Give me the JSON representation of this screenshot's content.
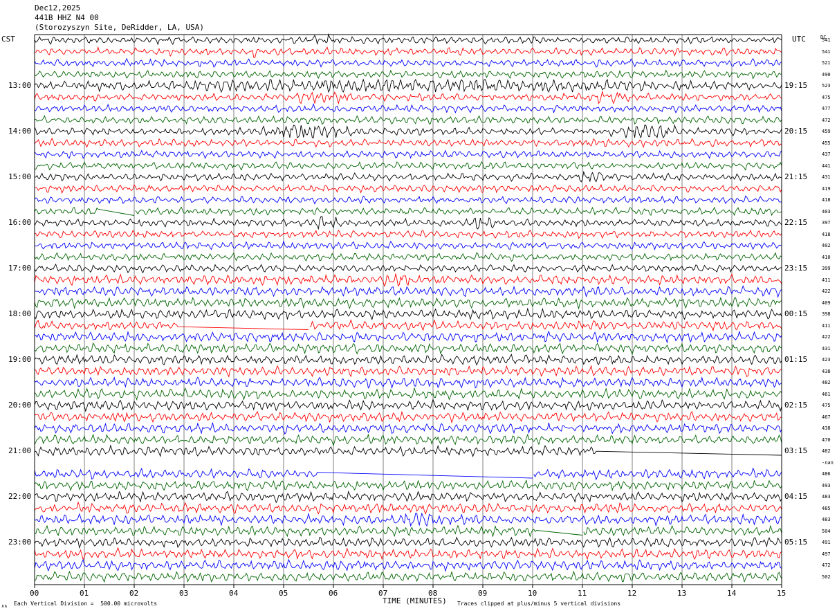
{
  "header": {
    "date": "Dec12,2025",
    "station": "441B HHZ N4 00",
    "site": "(Storozyszyn Site, DeRidder, LA, USA)"
  },
  "labels": {
    "left_zone": "CST",
    "right_zone": "UTC",
    "dc_label": "DC",
    "xlabel": "TIME (MINUTES)",
    "scale_note": "Each Vertical Division =  500.00 microvolts",
    "clip_note": "Traces clipped at plus/minus 5 vertical divisions",
    "corner_mark": "∧∧"
  },
  "chart_data": {
    "type": "line",
    "xlim": [
      0,
      15
    ],
    "x_ticks": [
      "00",
      "01",
      "02",
      "03",
      "04",
      "05",
      "06",
      "07",
      "08",
      "09",
      "10",
      "11",
      "12",
      "13",
      "14",
      "15"
    ],
    "left_hour_labels": [
      "13:00",
      "14:00",
      "15:00",
      "16:00",
      "17:00",
      "18:00",
      "19:00",
      "20:00",
      "21:00",
      "22:00",
      "23:00"
    ],
    "right_hour_labels": [
      "19:15",
      "20:15",
      "21:15",
      "22:15",
      "23:15",
      "00:15",
      "01:15",
      "02:15",
      "03:15",
      "04:15",
      "05:15"
    ],
    "trace_colors": [
      "#000000",
      "#ff0000",
      "#0000ff",
      "#006400"
    ],
    "traces_per_hour": 4,
    "trace_count": 48,
    "dc_offsets": [
      "541",
      "541",
      "521",
      "490",
      "523",
      "475",
      "477",
      "472",
      "459",
      "455",
      "437",
      "441",
      "431",
      "419",
      "418",
      "403",
      "397",
      "418",
      "402",
      "410",
      "399",
      "411",
      "422",
      "409",
      "398",
      "411",
      "422",
      "431",
      "423",
      "438",
      "482",
      "461",
      "475",
      "467",
      "438",
      "470",
      "482",
      "-nan",
      "486",
      "493",
      "483",
      "485",
      "483",
      "504",
      "491",
      "497",
      "472",
      "502"
    ],
    "events": [
      {
        "trace": 0,
        "start_min": 5.5,
        "end_min": 6.2,
        "amp": 1.4
      },
      {
        "trace": 1,
        "start_min": 4.2,
        "end_min": 4.6,
        "amp": 1.3
      },
      {
        "trace": 4,
        "start_min": 0.0,
        "end_min": 15.0,
        "amp": 1.6
      },
      {
        "trace": 5,
        "start_min": 5.0,
        "end_min": 6.5,
        "amp": 1.5
      },
      {
        "trace": 5,
        "start_min": 11.0,
        "end_min": 12.0,
        "amp": 1.5
      },
      {
        "trace": 8,
        "start_min": 4.5,
        "end_min": 6.5,
        "amp": 2.2
      },
      {
        "trace": 8,
        "start_min": 11.5,
        "end_min": 13.0,
        "amp": 2.0
      },
      {
        "trace": 12,
        "start_min": 10.8,
        "end_min": 11.5,
        "amp": 1.6
      },
      {
        "trace": 16,
        "start_min": 5.5,
        "end_min": 6.2,
        "amp": 1.8
      },
      {
        "trace": 16,
        "start_min": 8.6,
        "end_min": 9.3,
        "amp": 1.6
      },
      {
        "trace": 21,
        "start_min": 7.0,
        "end_min": 7.6,
        "amp": 1.5
      },
      {
        "trace": 42,
        "start_min": 7.3,
        "end_min": 8.2,
        "amp": 2.0
      }
    ],
    "gaps": [
      {
        "trace": 15,
        "start_min": 1.3,
        "end_min": 2.0
      },
      {
        "trace": 25,
        "start_min": 2.9,
        "end_min": 5.5
      },
      {
        "trace": 36,
        "start_min": 11.3,
        "end_min": 15.0
      },
      {
        "trace": 37,
        "start_min": 0.0,
        "end_min": 15.0
      },
      {
        "trace": 38,
        "start_min": 5.7,
        "end_min": 10.0
      },
      {
        "trace": 43,
        "start_min": 10.1,
        "end_min": 11.0
      }
    ]
  }
}
